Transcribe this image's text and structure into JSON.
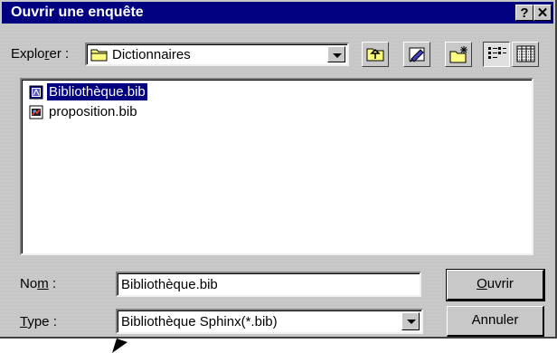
{
  "window": {
    "title": "Ouvrir une enquête",
    "help_label": "?",
    "close_label": "✕"
  },
  "lookin": {
    "label_pre": "Explo",
    "label_ul": "r",
    "label_post": "er :",
    "value": "Dictionnaires"
  },
  "toolbar": {
    "up_icon": "up-folder-icon",
    "desktop_icon": "desktop-icon",
    "new_folder_icon": "new-folder-icon",
    "list_view_icon": "list-view-icon",
    "details_view_icon": "details-view-icon"
  },
  "files": [
    {
      "name": "Bibliothèque.bib",
      "selected": true
    },
    {
      "name": "proposition.bib",
      "selected": false
    }
  ],
  "filename": {
    "label_pre": "No",
    "label_ul": "m",
    "label_post": " :",
    "value": "Bibliothèque.bib"
  },
  "filetype": {
    "label_pre": "",
    "label_ul": "T",
    "label_post": "ype :",
    "value": "Bibliothèque Sphinx(*.bib)"
  },
  "buttons": {
    "open_ul": "O",
    "open_rest": "uvrir",
    "cancel": "Annuler"
  },
  "colors": {
    "titlebar": "#000080",
    "selection": "#000080",
    "face": "#c8c8c8"
  }
}
